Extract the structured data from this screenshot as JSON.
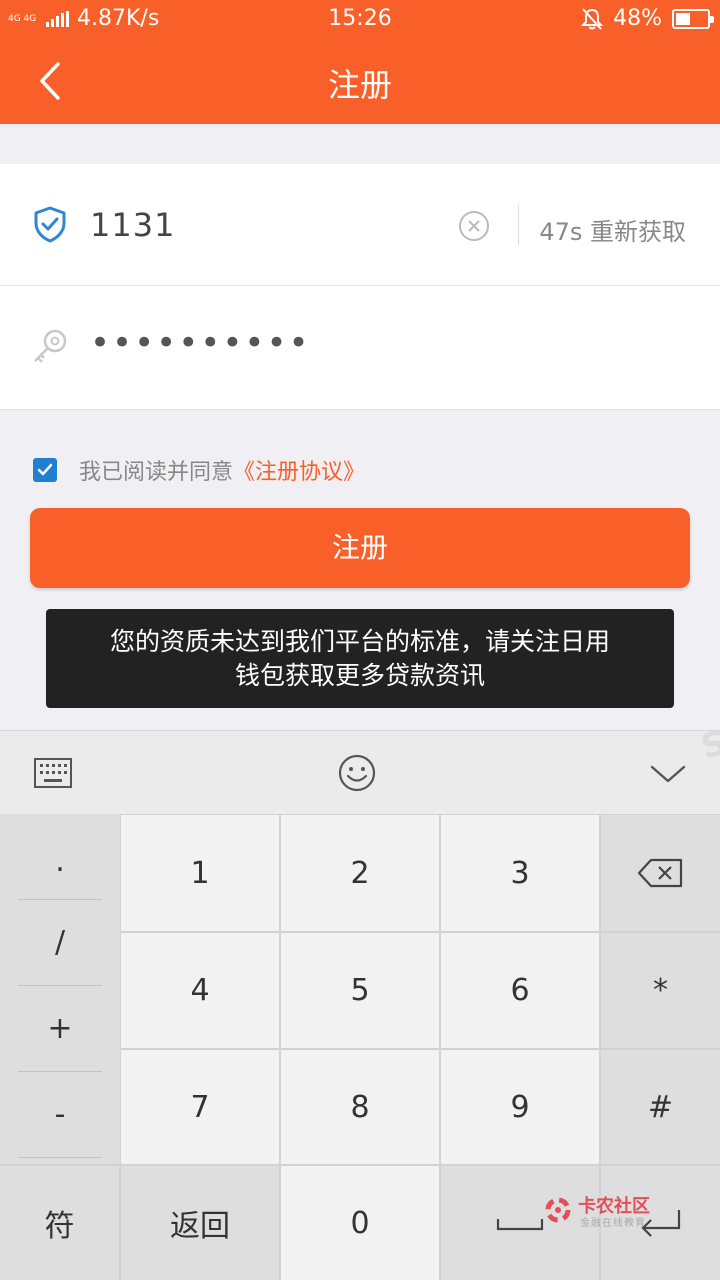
{
  "status_bar": {
    "network": "4G 4G",
    "speed": "4.87K/s",
    "time": "15:26",
    "battery": "48%",
    "battery_level": 0.48,
    "icons": [
      "signal-icon",
      "bell-muted-icon",
      "battery-icon"
    ]
  },
  "header": {
    "title": "注册",
    "back_icon": "back-arrow-icon"
  },
  "form": {
    "code_value": "1131",
    "resend_label": "47s 重新获取",
    "password_value": "••••••••••",
    "icons": [
      "shield-check-icon",
      "clear-icon",
      "key-icon"
    ]
  },
  "agreement": {
    "checked": true,
    "text": "我已阅读并同意",
    "link": "《注册协议》"
  },
  "submit_label": "注册",
  "toast": {
    "line1": "您的资质未达到我们平台的标准，请关注日用",
    "line2": "钱包获取更多贷款资讯"
  },
  "keyboard": {
    "toolbar_icons": [
      "keyboard-icon",
      "emoji-icon",
      "collapse-icon"
    ],
    "symbols": [
      ".",
      "/",
      "+",
      "-"
    ],
    "digits": [
      "1",
      "2",
      "3",
      "4",
      "5",
      "6",
      "7",
      "8",
      "9"
    ],
    "side_keys": [
      "*",
      "#"
    ],
    "bottom": {
      "symbol_label": "符",
      "back_label": "返回",
      "zero": "0"
    }
  },
  "watermark": {
    "title": "卡农社区",
    "subtitle": "金融在线教育"
  },
  "colors": {
    "accent": "#f95f28",
    "checkbox": "#1f7fd1",
    "toast_bg": "#222222"
  }
}
